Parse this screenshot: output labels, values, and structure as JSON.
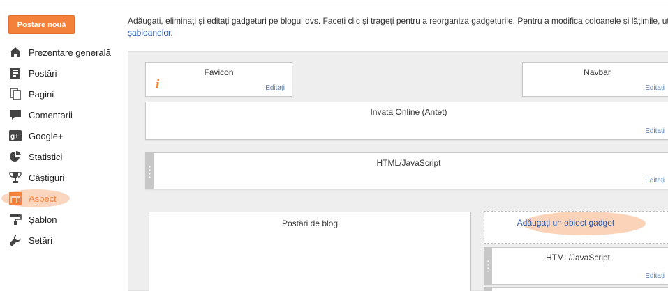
{
  "sidebar": {
    "new_post_label": "Postare nouă",
    "items": [
      {
        "label": "Prezentare generală",
        "icon": "home-icon"
      },
      {
        "label": "Postări",
        "icon": "posts-icon"
      },
      {
        "label": "Pagini",
        "icon": "pages-icon"
      },
      {
        "label": "Comentarii",
        "icon": "comment-icon"
      },
      {
        "label": "Google+",
        "icon": "google-plus-icon"
      },
      {
        "label": "Statistici",
        "icon": "pie-chart-icon"
      },
      {
        "label": "Câștiguri",
        "icon": "trophy-icon"
      },
      {
        "label": "Aspect",
        "icon": "layout-icon",
        "active": true
      },
      {
        "label": "Șablon",
        "icon": "paint-roller-icon"
      },
      {
        "label": "Setări",
        "icon": "wrench-icon"
      }
    ]
  },
  "description": {
    "text": "Adăugați, eliminați și editați gadgeturi pe blogul dvs. Faceți clic și trageți pentru a reorganiza gadgeturile. Pentru a modifica coloanele și lățimile, utilizați",
    "link": "șabloanelor",
    "suffix": "."
  },
  "layout": {
    "favicon": {
      "title": "Favicon",
      "edit": "Editați",
      "icon": "info-icon"
    },
    "navbar": {
      "title": "Navbar",
      "edit": "Editați"
    },
    "header": {
      "title": "Invata Online (Antet)",
      "edit": "Editați"
    },
    "html_js_1": {
      "title": "HTML/JavaScript",
      "edit": "Editați"
    },
    "blog_posts": {
      "title": "Postări de blog"
    },
    "add_gadget": {
      "label": "Adăugați un obiect gadget"
    },
    "html_js_2": {
      "title": "HTML/JavaScript",
      "edit": "Editați"
    }
  },
  "colors": {
    "accent": "#f3813a",
    "link": "#2a5db0",
    "highlight": "#f9c8a8"
  }
}
